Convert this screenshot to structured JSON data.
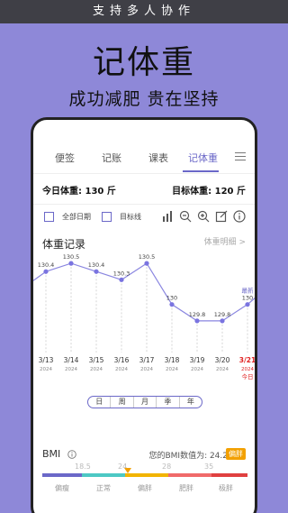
{
  "banner": {
    "text": "支持多人协作"
  },
  "hero": {
    "title": "记体重",
    "subtitle": "成功减肥 贵在坚持"
  },
  "tabs": [
    {
      "label": "便签"
    },
    {
      "label": "记账"
    },
    {
      "label": "课表"
    },
    {
      "label": "记体重",
      "active": true
    }
  ],
  "summary": {
    "today_label": "今日体重: 130 斤",
    "target_label": "目标体重: 120 斤"
  },
  "toolbar": {
    "all_dates_label": "全部日期",
    "target_line_label": "目标线"
  },
  "section": {
    "title": "体重记录",
    "detail_link": "体重明细 >"
  },
  "chart_data": {
    "type": "line",
    "categories": [
      "3/13",
      "3/14",
      "3/15",
      "3/16",
      "3/17",
      "3/18",
      "3/19",
      "3/20",
      "3/21"
    ],
    "years": [
      "2024",
      "2024",
      "2024",
      "2024",
      "2024",
      "2024",
      "2024",
      "2024",
      "2024"
    ],
    "values": [
      130.4,
      130.5,
      130.4,
      130.3,
      130.5,
      130,
      129.8,
      129.8,
      130
    ],
    "latest_label": "最新",
    "today_label": "今日",
    "colors": {
      "line": "#8a86e0",
      "point": "#7a74e0",
      "highlight": "#e02020"
    }
  },
  "ranges": [
    {
      "label": "日",
      "active": true
    },
    {
      "label": "周"
    },
    {
      "label": "月"
    },
    {
      "label": "季"
    },
    {
      "label": "年"
    }
  ],
  "bmi": {
    "title": "BMI",
    "value_label": "您的BMI数值为: 24.2",
    "badge": "偏胖",
    "scale": [
      "18.5",
      "24",
      "28",
      "35"
    ],
    "categories": [
      "偏瘦",
      "正常",
      "偏胖",
      "肥胖",
      "极胖"
    ],
    "colors": [
      "#6b68c8",
      "#4dc8c4",
      "#f2b400",
      "#f06a6a",
      "#e04040"
    ]
  }
}
